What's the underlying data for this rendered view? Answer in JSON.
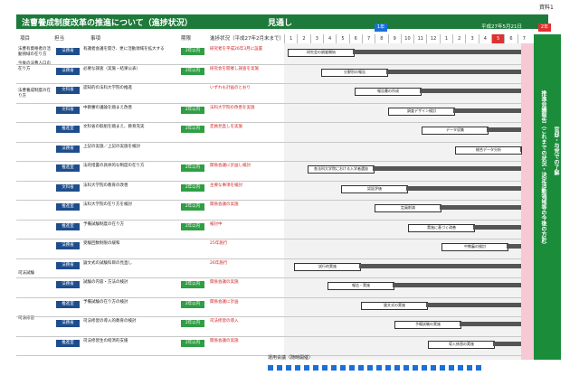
{
  "doc_label": "資料1",
  "header": {
    "title": "法曹養成制度改革の推進について（進捗状況）",
    "arrow_label": "見通し",
    "date": "平成27年5月21日",
    "year_tag_1": "1年",
    "year_tag_2": "2年"
  },
  "columns": {
    "item": "項目",
    "owner": "担当",
    "task": "事項",
    "deadline": "期限",
    "status": "進捗状況（平成27年2月末まで）"
  },
  "months": [
    "1",
    "2",
    "3",
    "4",
    "5",
    "6",
    "7",
    "8",
    "9",
    "10",
    "11",
    "12",
    "1",
    "2",
    "3",
    "4",
    "5",
    "6",
    "7"
  ],
  "highlight_month_index": 16,
  "sections": [
    {
      "label": "法曹有資格者の活動領域の在り方"
    },
    {
      "label": "今後の法曹人口の在り方"
    },
    {
      "label": "法曹養成制度の在り方"
    },
    {
      "label": "司法試験"
    },
    {
      "label": "司法修習"
    }
  ],
  "right_band": {
    "text1": "推進会議報告（これまでの状況・決定活動領域等の今後の方針）",
    "text2": "官邸・与党での了解"
  },
  "rows": [
    {
      "owner": "法務省",
      "task": "有識者会議を開き、更に活動領域を拡大する",
      "deadline": "2年以内",
      "status": "研究者を平成26年3月に設置"
    },
    {
      "owner": "法務省",
      "task": "必要な調査（実施・結果公表）",
      "deadline": "2年以内",
      "status": "研究会を開催し調査を実施"
    },
    {
      "owner": "文科省",
      "task": "認知的の法科大学院の推進",
      "deadline": "",
      "status": "いずれも計画のとおり"
    },
    {
      "owner": "文科省",
      "task": "中教審の議論を踏まえ改善",
      "deadline": "2年以内",
      "status": "法科大学院の改善を実施"
    },
    {
      "owner": "推進室",
      "task": "文科省の取組を踏まえ、教育充実",
      "deadline": "2年以内",
      "status": "定員見直しを実施"
    },
    {
      "owner": "法務省",
      "task": "上記の実施／上記の実施を検討",
      "deadline": "",
      "status": ""
    },
    {
      "owner": "推進室",
      "task": "法的措置の具体的な制度の在り方",
      "deadline": "2年以内",
      "status": "関係会議に計画し検討"
    },
    {
      "owner": "文科省",
      "task": "法科大学院の教育の改善",
      "deadline": "2年以内",
      "status": "主要な事項を検討"
    },
    {
      "owner": "推進室",
      "task": "法科大学院の在り方を検討",
      "deadline": "2年以内",
      "status": "関係会議の実施"
    },
    {
      "owner": "推進室",
      "task": "予備試験制度の在り方",
      "deadline": "2年以内",
      "status": "検討中"
    },
    {
      "owner": "法務省",
      "task": "受験回数制限の緩和",
      "deadline": "",
      "status": "25年施行"
    },
    {
      "owner": "法務省",
      "task": "論文式の試験科目の見直し",
      "deadline": "",
      "status": "26年施行"
    },
    {
      "owner": "法務省",
      "task": "試験の内容・方法の検討",
      "deadline": "2年以内",
      "status": "関係会議の実施"
    },
    {
      "owner": "推進室",
      "task": "予備試験の在り方の検討",
      "deadline": "2年以内",
      "status": "関係会議に計画"
    },
    {
      "owner": "法務省",
      "task": "司法修習の導入的教育の検討",
      "deadline": "2年以内",
      "status": "司法修習の導入"
    },
    {
      "owner": "推進室",
      "task": "司法修習生の経済的支援",
      "deadline": "2年以内",
      "status": "関係会議の実施"
    }
  ],
  "timeline_boxes": [
    "研究会の調査開始",
    "分野別の報告",
    "報告書の作成",
    "調査デザイン検討",
    "データ収集",
    "総合データ分析",
    "各法科大学院における入学者選抜",
    "認証評価",
    "定員削減",
    "実施に基づく改善",
    "中教審の検討",
    "試行的実施",
    "報告・実施",
    "論文式の実施",
    "予備試験の実施",
    "導入修習の実施"
  ],
  "footer_note": "運用会議（随時開催）"
}
